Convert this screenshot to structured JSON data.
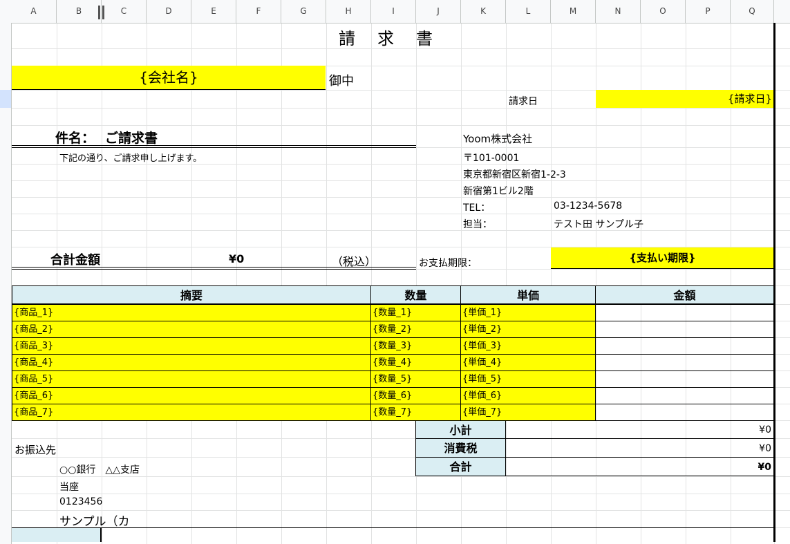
{
  "columns": [
    "A",
    "B",
    "C",
    "D",
    "E",
    "F",
    "G",
    "H",
    "I",
    "J",
    "K",
    "L",
    "M",
    "N",
    "O",
    "P",
    "Q"
  ],
  "invoice": {
    "title": "請　求　書",
    "company_placeholder": "{会社名}",
    "honorific": "御中",
    "date_label": "請求日",
    "date_placeholder": "{請求日}",
    "subject_label": "件名：",
    "subject_value": "ご請求書",
    "intro_text": "下記の通り、ご請求申し上げます。",
    "total_label": "合計金額",
    "total_value": "¥0",
    "tax_included": "（税込）",
    "due_label": "お支払期限：",
    "due_placeholder": "{支払い期限}"
  },
  "issuer": {
    "name": "Yoom株式会社",
    "postal": "〒101-0001",
    "address1": "東京都新宿区新宿1-2-3",
    "address2": "新宿第1ビル2階",
    "tel_label": "TEL：",
    "tel_value": "03-1234-5678",
    "contact_label": "担当：",
    "contact_value": "テスト田 サンプル子"
  },
  "table": {
    "headers": {
      "item": "摘要",
      "qty": "数量",
      "price": "単価",
      "amount": "金額"
    },
    "rows": [
      {
        "item": "{商品_1}",
        "qty": "{数量_1}",
        "price": "{単価_1}"
      },
      {
        "item": "{商品_2}",
        "qty": "{数量_2}",
        "price": "{単価_2}"
      },
      {
        "item": "{商品_3}",
        "qty": "{数量_3}",
        "price": "{単価_3}"
      },
      {
        "item": "{商品_4}",
        "qty": "{数量_4}",
        "price": "{単価_4}"
      },
      {
        "item": "{商品_5}",
        "qty": "{数量_5}",
        "price": "{単価_5}"
      },
      {
        "item": "{商品_6}",
        "qty": "{数量_6}",
        "price": "{単価_6}"
      },
      {
        "item": "{商品_7}",
        "qty": "{数量_7}",
        "price": "{単価_7}"
      }
    ]
  },
  "summary": {
    "subtotal_label": "小計",
    "subtotal_value": "¥0",
    "tax_label": "消費税",
    "tax_value": "¥0",
    "total_label": "合計",
    "total_value": "¥0"
  },
  "bank": {
    "label": "お振込先",
    "bank_name": "○○銀行　△△支店",
    "account_type": "当座",
    "account_number": "0123456",
    "account_holder": "サンプル（カ"
  },
  "colors": {
    "highlight": "#ffff00",
    "header_fill": "#daeef3",
    "selected_row": "#d3e3fd"
  }
}
